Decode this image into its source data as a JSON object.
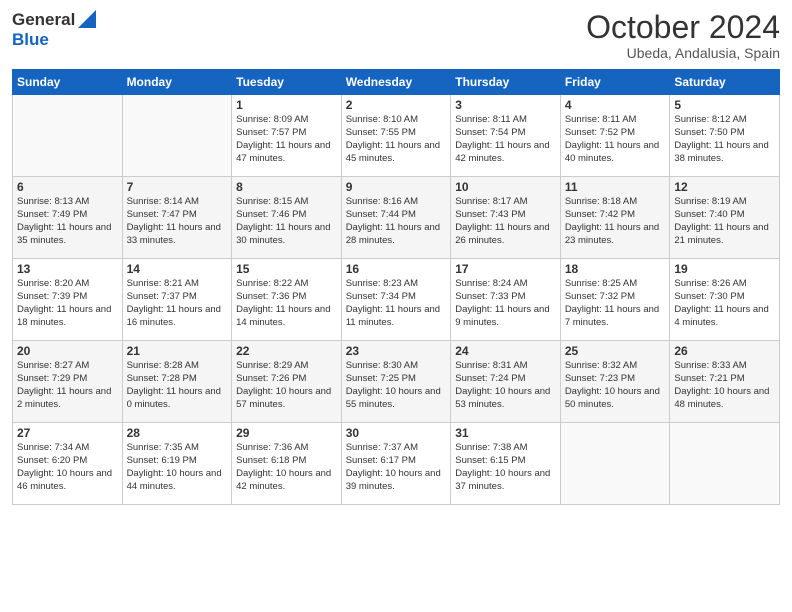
{
  "logo": {
    "line1": "General",
    "line2": "Blue"
  },
  "header": {
    "month_year": "October 2024",
    "location": "Ubeda, Andalusia, Spain"
  },
  "days_of_week": [
    "Sunday",
    "Monday",
    "Tuesday",
    "Wednesday",
    "Thursday",
    "Friday",
    "Saturday"
  ],
  "weeks": [
    [
      {
        "day": "",
        "info": ""
      },
      {
        "day": "",
        "info": ""
      },
      {
        "day": "1",
        "info": "Sunrise: 8:09 AM\nSunset: 7:57 PM\nDaylight: 11 hours and 47 minutes."
      },
      {
        "day": "2",
        "info": "Sunrise: 8:10 AM\nSunset: 7:55 PM\nDaylight: 11 hours and 45 minutes."
      },
      {
        "day": "3",
        "info": "Sunrise: 8:11 AM\nSunset: 7:54 PM\nDaylight: 11 hours and 42 minutes."
      },
      {
        "day": "4",
        "info": "Sunrise: 8:11 AM\nSunset: 7:52 PM\nDaylight: 11 hours and 40 minutes."
      },
      {
        "day": "5",
        "info": "Sunrise: 8:12 AM\nSunset: 7:50 PM\nDaylight: 11 hours and 38 minutes."
      }
    ],
    [
      {
        "day": "6",
        "info": "Sunrise: 8:13 AM\nSunset: 7:49 PM\nDaylight: 11 hours and 35 minutes."
      },
      {
        "day": "7",
        "info": "Sunrise: 8:14 AM\nSunset: 7:47 PM\nDaylight: 11 hours and 33 minutes."
      },
      {
        "day": "8",
        "info": "Sunrise: 8:15 AM\nSunset: 7:46 PM\nDaylight: 11 hours and 30 minutes."
      },
      {
        "day": "9",
        "info": "Sunrise: 8:16 AM\nSunset: 7:44 PM\nDaylight: 11 hours and 28 minutes."
      },
      {
        "day": "10",
        "info": "Sunrise: 8:17 AM\nSunset: 7:43 PM\nDaylight: 11 hours and 26 minutes."
      },
      {
        "day": "11",
        "info": "Sunrise: 8:18 AM\nSunset: 7:42 PM\nDaylight: 11 hours and 23 minutes."
      },
      {
        "day": "12",
        "info": "Sunrise: 8:19 AM\nSunset: 7:40 PM\nDaylight: 11 hours and 21 minutes."
      }
    ],
    [
      {
        "day": "13",
        "info": "Sunrise: 8:20 AM\nSunset: 7:39 PM\nDaylight: 11 hours and 18 minutes."
      },
      {
        "day": "14",
        "info": "Sunrise: 8:21 AM\nSunset: 7:37 PM\nDaylight: 11 hours and 16 minutes."
      },
      {
        "day": "15",
        "info": "Sunrise: 8:22 AM\nSunset: 7:36 PM\nDaylight: 11 hours and 14 minutes."
      },
      {
        "day": "16",
        "info": "Sunrise: 8:23 AM\nSunset: 7:34 PM\nDaylight: 11 hours and 11 minutes."
      },
      {
        "day": "17",
        "info": "Sunrise: 8:24 AM\nSunset: 7:33 PM\nDaylight: 11 hours and 9 minutes."
      },
      {
        "day": "18",
        "info": "Sunrise: 8:25 AM\nSunset: 7:32 PM\nDaylight: 11 hours and 7 minutes."
      },
      {
        "day": "19",
        "info": "Sunrise: 8:26 AM\nSunset: 7:30 PM\nDaylight: 11 hours and 4 minutes."
      }
    ],
    [
      {
        "day": "20",
        "info": "Sunrise: 8:27 AM\nSunset: 7:29 PM\nDaylight: 11 hours and 2 minutes."
      },
      {
        "day": "21",
        "info": "Sunrise: 8:28 AM\nSunset: 7:28 PM\nDaylight: 11 hours and 0 minutes."
      },
      {
        "day": "22",
        "info": "Sunrise: 8:29 AM\nSunset: 7:26 PM\nDaylight: 10 hours and 57 minutes."
      },
      {
        "day": "23",
        "info": "Sunrise: 8:30 AM\nSunset: 7:25 PM\nDaylight: 10 hours and 55 minutes."
      },
      {
        "day": "24",
        "info": "Sunrise: 8:31 AM\nSunset: 7:24 PM\nDaylight: 10 hours and 53 minutes."
      },
      {
        "day": "25",
        "info": "Sunrise: 8:32 AM\nSunset: 7:23 PM\nDaylight: 10 hours and 50 minutes."
      },
      {
        "day": "26",
        "info": "Sunrise: 8:33 AM\nSunset: 7:21 PM\nDaylight: 10 hours and 48 minutes."
      }
    ],
    [
      {
        "day": "27",
        "info": "Sunrise: 7:34 AM\nSunset: 6:20 PM\nDaylight: 10 hours and 46 minutes."
      },
      {
        "day": "28",
        "info": "Sunrise: 7:35 AM\nSunset: 6:19 PM\nDaylight: 10 hours and 44 minutes."
      },
      {
        "day": "29",
        "info": "Sunrise: 7:36 AM\nSunset: 6:18 PM\nDaylight: 10 hours and 42 minutes."
      },
      {
        "day": "30",
        "info": "Sunrise: 7:37 AM\nSunset: 6:17 PM\nDaylight: 10 hours and 39 minutes."
      },
      {
        "day": "31",
        "info": "Sunrise: 7:38 AM\nSunset: 6:15 PM\nDaylight: 10 hours and 37 minutes."
      },
      {
        "day": "",
        "info": ""
      },
      {
        "day": "",
        "info": ""
      }
    ]
  ]
}
